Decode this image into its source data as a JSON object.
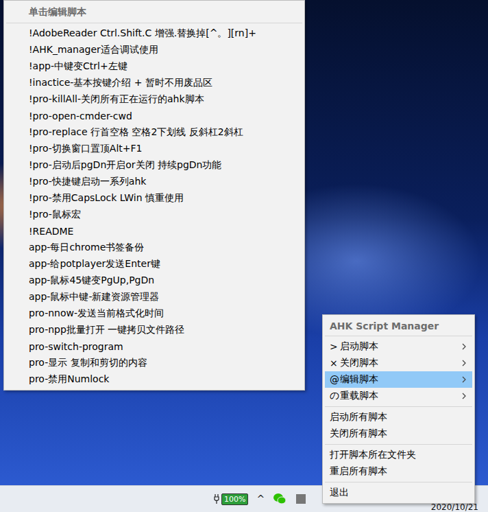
{
  "edit_submenu": {
    "header": "单击编辑脚本",
    "items": [
      {
        "label": "!AdobeReader Ctrl.Shift.C 增强.替换掉[^。][rn]+"
      },
      {
        "label": "!AHK_manager适合调试使用"
      },
      {
        "label": "!app-中键变Ctrl+左键"
      },
      {
        "label": "!inactice-基本按键介绍 + 暂时不用废品区"
      },
      {
        "label": "!pro-killAll-关闭所有正在运行的ahk脚本"
      },
      {
        "label": "!pro-open-cmder-cwd"
      },
      {
        "label": "!pro-replace 行首空格 空格2下划线 反斜杠2斜杠"
      },
      {
        "label": "!pro-切换窗口置顶Alt+F1"
      },
      {
        "label": "!pro-启动后pgDn开启or关闭 持续pgDn功能"
      },
      {
        "label": "!pro-快捷键启动一系列ahk"
      },
      {
        "label": "!pro-禁用CapsLock LWin 慎重使用"
      },
      {
        "label": "!pro-鼠标宏"
      },
      {
        "label": "!README"
      },
      {
        "label": "app-每日chrome书签备份"
      },
      {
        "label": "app-给potplayer发送Enter键"
      },
      {
        "label": "app-鼠标45键变PgUp,PgDn"
      },
      {
        "label": "app-鼠标中键-新建资源管理器"
      },
      {
        "label": "pro-nnow-发送当前格式化时间"
      },
      {
        "label": "pro-npp批量打开 一键拷贝文件路径"
      },
      {
        "label": "pro-switch-program"
      },
      {
        "label": "pro-显示 复制和剪切的内容"
      },
      {
        "label": "pro-禁用Numlock"
      }
    ]
  },
  "tray_menu": {
    "header": "AHK Script Manager",
    "sections": [
      [
        {
          "prefix": ">",
          "label": "启动脚本",
          "submenu": true,
          "selected": false
        },
        {
          "prefix": "×",
          "label": "关闭脚本",
          "submenu": true,
          "selected": false
        },
        {
          "prefix": "@",
          "label": "编辑脚本",
          "submenu": true,
          "selected": true
        },
        {
          "prefix": "の",
          "label": "重载脚本",
          "submenu": true,
          "selected": false
        }
      ],
      [
        {
          "prefix": "",
          "label": "启动所有脚本",
          "submenu": false,
          "selected": false
        },
        {
          "prefix": "",
          "label": "关闭所有脚本",
          "submenu": false,
          "selected": false
        }
      ],
      [
        {
          "prefix": "",
          "label": "打开脚本所在文件夹",
          "submenu": false,
          "selected": false
        },
        {
          "prefix": "",
          "label": "重启所有脚本",
          "submenu": false,
          "selected": false
        }
      ],
      [
        {
          "prefix": "",
          "label": "退出",
          "submenu": false,
          "selected": false
        }
      ]
    ]
  },
  "taskbar": {
    "battery": "100%",
    "tray_toggle": "^",
    "date": "2020/10/21"
  }
}
